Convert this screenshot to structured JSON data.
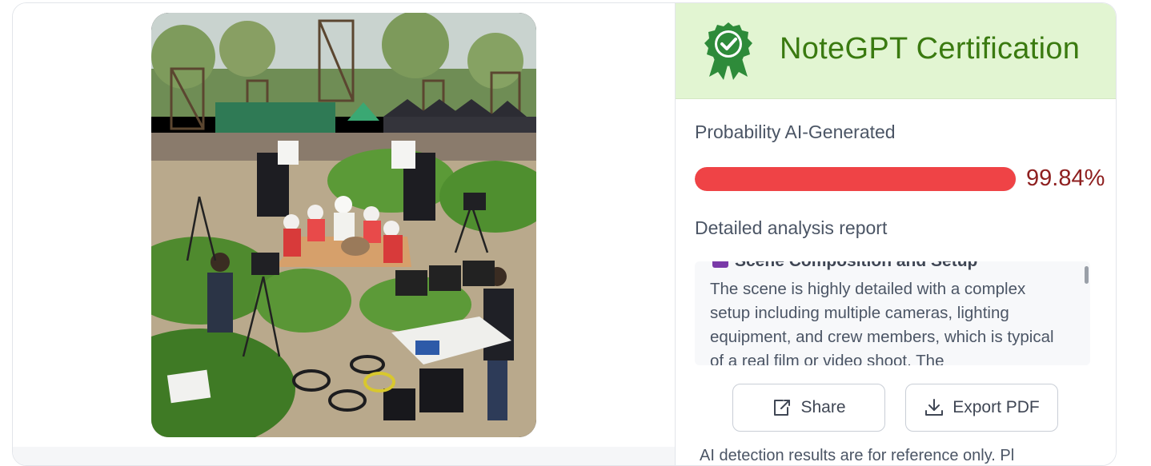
{
  "certification": {
    "title": "NoteGPT Certification",
    "badge_icon": "certified-badge-icon",
    "badge_color": "#2e8b3a"
  },
  "probability": {
    "label": "Probability AI-Generated",
    "value_text": "99.84%",
    "value": 99.84,
    "bar_color": "#ef4346"
  },
  "report": {
    "label": "Detailed analysis report",
    "section_icon": "camera-icon",
    "section_heading": "Scene Composition and Setup",
    "section_text": "The scene is highly detailed with a complex setup including multiple cameras, lighting equipment, and crew members, which is typical of a real film or video shoot. The"
  },
  "actions": {
    "share_label": "Share",
    "share_icon": "share-icon",
    "export_label": "Export PDF",
    "export_icon": "download-icon"
  },
  "footer": {
    "text": "AI detection results are for reference only. Pl"
  },
  "image": {
    "alt": "Film set in a tea garden with cameras, lights, crew and seated performers"
  }
}
